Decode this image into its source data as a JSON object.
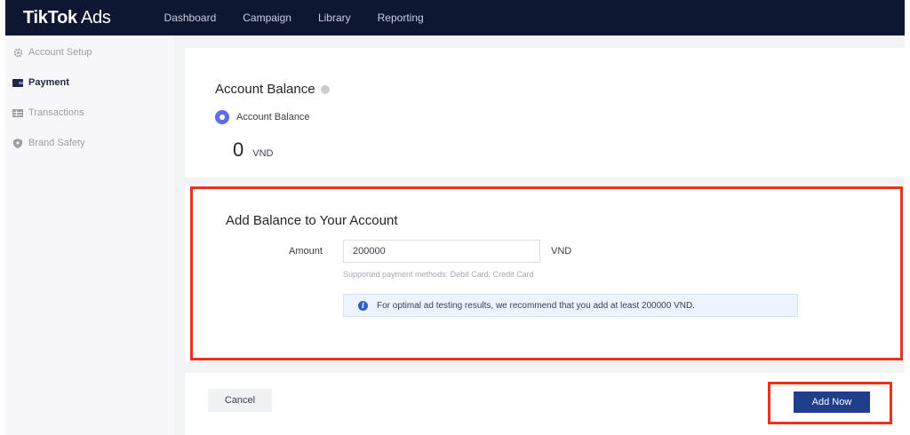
{
  "header": {
    "logo_bold": "TikTok",
    "logo_thin": " Ads",
    "nav": [
      {
        "label": "Dashboard"
      },
      {
        "label": "Campaign"
      },
      {
        "label": "Library"
      },
      {
        "label": "Reporting"
      }
    ]
  },
  "sidebar": {
    "items": [
      {
        "label": "Account Setup",
        "icon": "gear-icon",
        "active": false
      },
      {
        "label": "Payment",
        "icon": "wallet-icon",
        "active": true
      },
      {
        "label": "Transactions",
        "icon": "list-icon",
        "active": false
      },
      {
        "label": "Brand Safety",
        "icon": "shield-icon",
        "active": false
      }
    ]
  },
  "balance": {
    "title": "Account Balance",
    "option_label": "Account Balance",
    "value": "0",
    "currency": "VND"
  },
  "add_balance": {
    "title": "Add Balance to Your Account",
    "amount_label": "Amount",
    "amount_value": "200000",
    "currency": "VND",
    "hint": "Supported payment methods: Debit Card, Credit Card",
    "notice": "For optimal ad testing results, we recommend that you add at least 200000 VND."
  },
  "footer": {
    "cancel_label": "Cancel",
    "add_label": "Add Now"
  },
  "colors": {
    "header_bg": "#0e1731",
    "primary": "#1f3f8c",
    "radio": "#5b6ee8",
    "highlight": "#e8321e"
  }
}
